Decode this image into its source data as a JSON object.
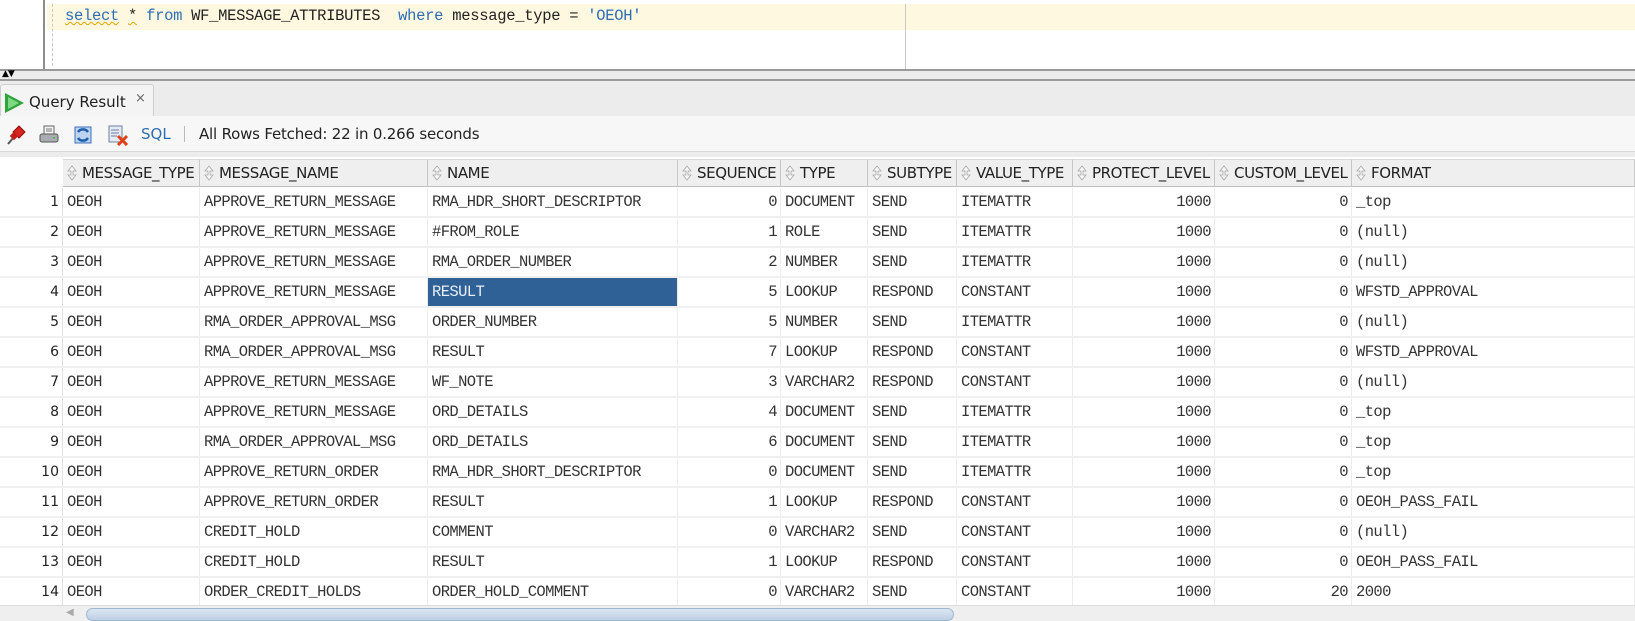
{
  "editor": {
    "sql_parts": {
      "select": "select",
      "star": "*",
      "from": "from",
      "table": "WF_MESSAGE_ATTRIBUTES",
      "where": "where",
      "condition": "message_type =",
      "literal": "'OEOH'"
    }
  },
  "results_tab": {
    "label": "Query Result",
    "close_glyph": "×"
  },
  "toolbar": {
    "icons": [
      "pin-icon",
      "print-icon",
      "refresh-icon",
      "clear-results-icon"
    ],
    "sql_label": "SQL",
    "status": "All Rows Fetched: 22 in 0.266 seconds"
  },
  "grid": {
    "columns": [
      "MESSAGE_TYPE",
      "MESSAGE_NAME",
      "NAME",
      "SEQUENCE",
      "TYPE",
      "SUBTYPE",
      "VALUE_TYPE",
      "PROTECT_LEVEL",
      "CUSTOM_LEVEL",
      "FORMAT"
    ],
    "selected_cell": {
      "row": 4,
      "column": "NAME"
    },
    "rows": [
      {
        "n": "1",
        "cells": [
          "OEOH",
          "APPROVE_RETURN_MESSAGE",
          "RMA_HDR_SHORT_DESCRIPTOR",
          "0",
          "DOCUMENT",
          "SEND",
          "ITEMATTR",
          "1000",
          "0",
          "_top"
        ]
      },
      {
        "n": "2",
        "cells": [
          "OEOH",
          "APPROVE_RETURN_MESSAGE",
          "#FROM_ROLE",
          "1",
          "ROLE",
          "SEND",
          "ITEMATTR",
          "1000",
          "0",
          "(null)"
        ]
      },
      {
        "n": "3",
        "cells": [
          "OEOH",
          "APPROVE_RETURN_MESSAGE",
          "RMA_ORDER_NUMBER",
          "2",
          "NUMBER",
          "SEND",
          "ITEMATTR",
          "1000",
          "0",
          "(null)"
        ]
      },
      {
        "n": "4",
        "cells": [
          "OEOH",
          "APPROVE_RETURN_MESSAGE",
          "RESULT",
          "5",
          "LOOKUP",
          "RESPOND",
          "CONSTANT",
          "1000",
          "0",
          "WFSTD_APPROVAL"
        ]
      },
      {
        "n": "5",
        "cells": [
          "OEOH",
          "RMA_ORDER_APPROVAL_MSG",
          "ORDER_NUMBER",
          "5",
          "NUMBER",
          "SEND",
          "ITEMATTR",
          "1000",
          "0",
          "(null)"
        ]
      },
      {
        "n": "6",
        "cells": [
          "OEOH",
          "RMA_ORDER_APPROVAL_MSG",
          "RESULT",
          "7",
          "LOOKUP",
          "RESPOND",
          "CONSTANT",
          "1000",
          "0",
          "WFSTD_APPROVAL"
        ]
      },
      {
        "n": "7",
        "cells": [
          "OEOH",
          "APPROVE_RETURN_MESSAGE",
          "WF_NOTE",
          "3",
          "VARCHAR2",
          "RESPOND",
          "CONSTANT",
          "1000",
          "0",
          "(null)"
        ]
      },
      {
        "n": "8",
        "cells": [
          "OEOH",
          "APPROVE_RETURN_MESSAGE",
          "ORD_DETAILS",
          "4",
          "DOCUMENT",
          "SEND",
          "ITEMATTR",
          "1000",
          "0",
          "_top"
        ]
      },
      {
        "n": "9",
        "cells": [
          "OEOH",
          "RMA_ORDER_APPROVAL_MSG",
          "ORD_DETAILS",
          "6",
          "DOCUMENT",
          "SEND",
          "ITEMATTR",
          "1000",
          "0",
          "_top"
        ]
      },
      {
        "n": "10",
        "cells": [
          "OEOH",
          "APPROVE_RETURN_ORDER",
          "RMA_HDR_SHORT_DESCRIPTOR",
          "0",
          "DOCUMENT",
          "SEND",
          "ITEMATTR",
          "1000",
          "0",
          "_top"
        ]
      },
      {
        "n": "11",
        "cells": [
          "OEOH",
          "APPROVE_RETURN_ORDER",
          "RESULT",
          "1",
          "LOOKUP",
          "RESPOND",
          "CONSTANT",
          "1000",
          "0",
          "OEOH_PASS_FAIL"
        ]
      },
      {
        "n": "12",
        "cells": [
          "OEOH",
          "CREDIT_HOLD",
          "COMMENT",
          "0",
          "VARCHAR2",
          "SEND",
          "CONSTANT",
          "1000",
          "0",
          "(null)"
        ]
      },
      {
        "n": "13",
        "cells": [
          "OEOH",
          "CREDIT_HOLD",
          "RESULT",
          "1",
          "LOOKUP",
          "RESPOND",
          "CONSTANT",
          "1000",
          "0",
          "OEOH_PASS_FAIL"
        ]
      },
      {
        "n": "14",
        "cells": [
          "OEOH",
          "ORDER_CREDIT_HOLDS",
          "ORDER_HOLD_COMMENT",
          "0",
          "VARCHAR2",
          "SEND",
          "CONSTANT",
          "1000",
          "20",
          "2000"
        ]
      }
    ]
  },
  "scrollbar": {
    "horizontal_arrow": "◀"
  }
}
